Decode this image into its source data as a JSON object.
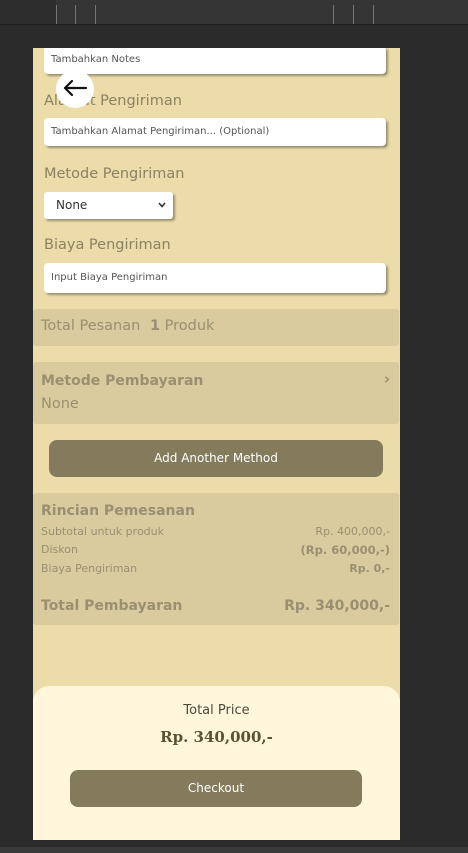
{
  "form": {
    "notes_placeholder": "Tambahkan Notes",
    "address_label": "Alamat Pengiriman",
    "address_placeholder": "Tambahkan Alamat Pengiriman... (Optional)",
    "shipping_method_label": "Metode Pengiriman",
    "shipping_method_value": "None",
    "shipping_cost_label": "Biaya Pengiriman",
    "shipping_cost_placeholder": "Input Biaya Pengiriman"
  },
  "order_total": {
    "label": "Total Pesanan",
    "count": "1",
    "unit": "Produk"
  },
  "payment": {
    "label": "Metode Pembayaran",
    "value": "None",
    "chevron": "›",
    "add_button": "Add Another Method"
  },
  "details": {
    "title": "Rincian Pemesanan",
    "rows": [
      {
        "label": "Subtotal untuk produk",
        "value": "Rp. 400,000,-"
      },
      {
        "label": "Diskon",
        "value": "(Rp. 60,000,-)"
      },
      {
        "label": "Biaya Pengiriman",
        "value": "Rp. 0,-"
      }
    ],
    "total_label": "Total Pembayaran",
    "total_value": "Rp. 340,000,-"
  },
  "footer": {
    "total_price_label": "Total Price",
    "total_price_value": "Rp. 340,000,-",
    "checkout_label": "Checkout"
  },
  "icons": {
    "back": "arrow-left",
    "dropdown": "chevron-down",
    "payment_chevron": "chevron-right"
  }
}
